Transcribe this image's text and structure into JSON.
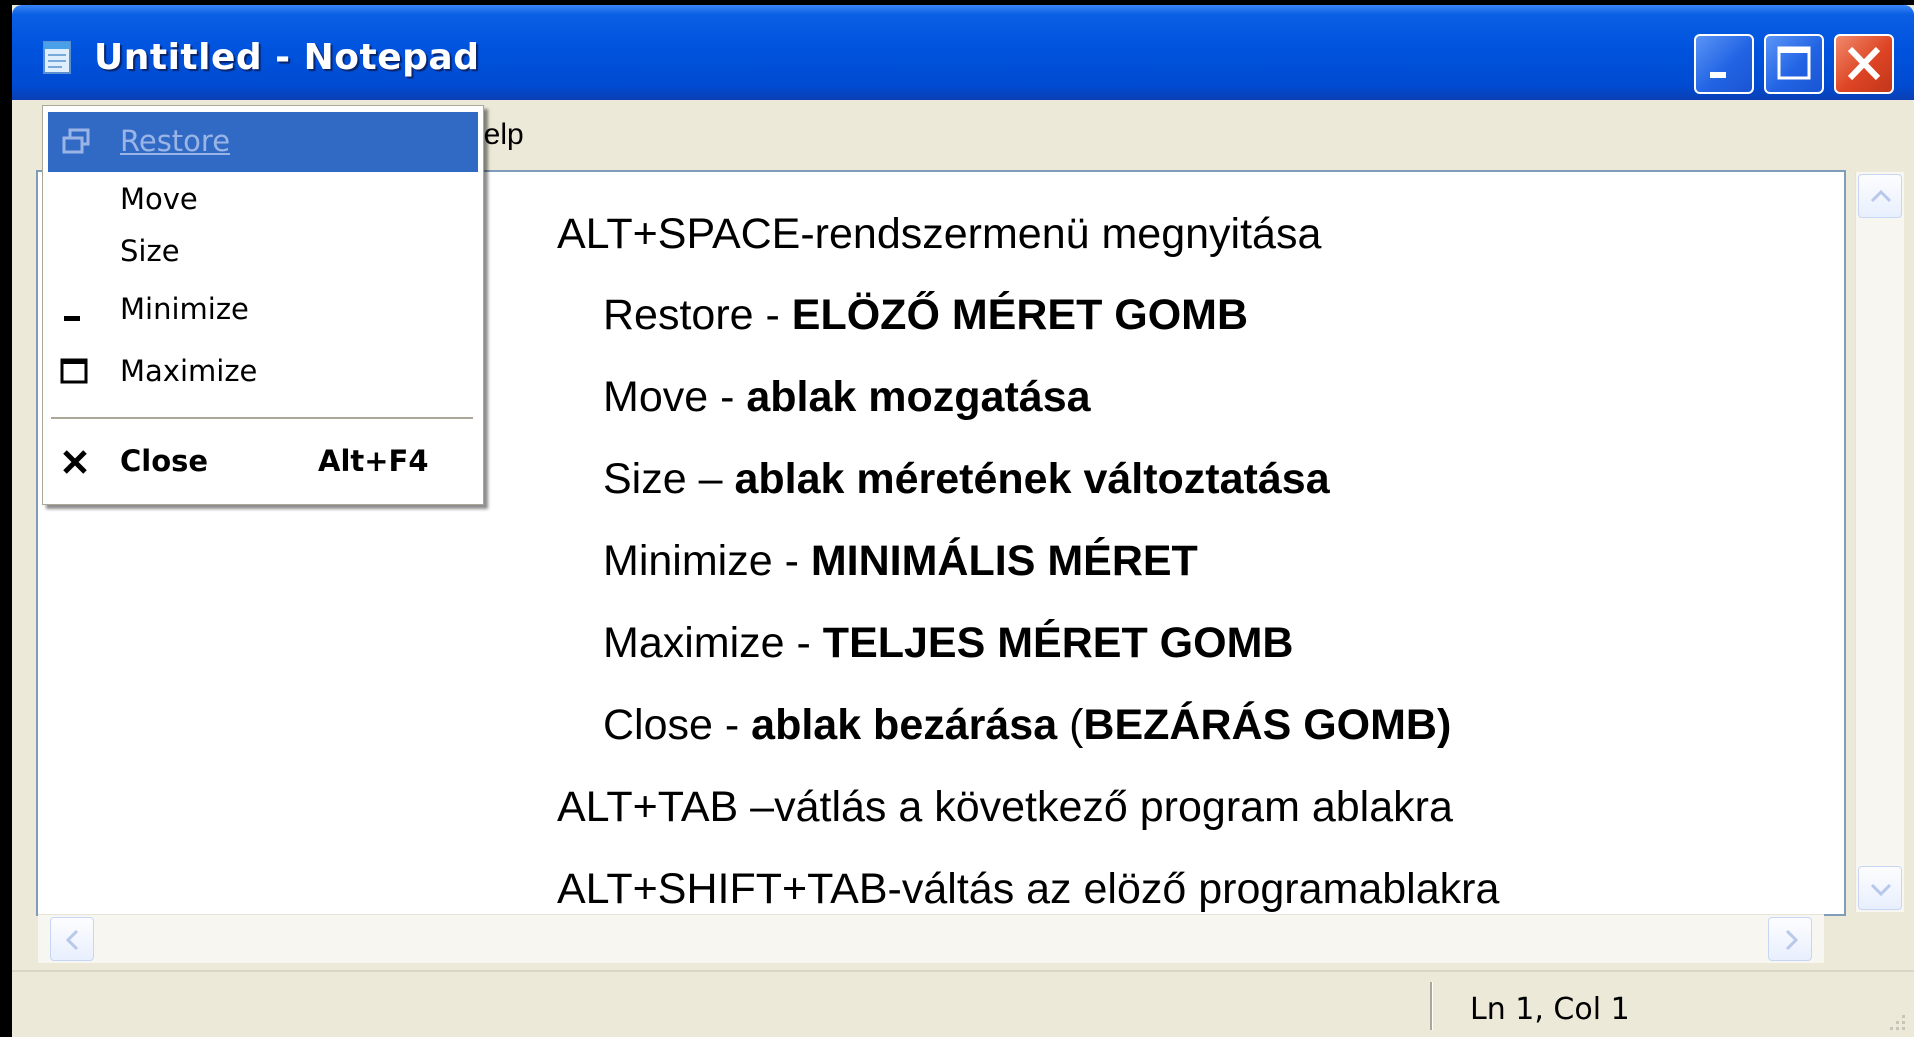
{
  "window": {
    "title": "Untitled - Notepad",
    "menu_help": "Help"
  },
  "system_menu": {
    "items": [
      {
        "label": "Restore",
        "icon": "restore-icon",
        "state": "highlighted-disabled"
      },
      {
        "label": "Move"
      },
      {
        "label": "Size"
      },
      {
        "label": "Minimize",
        "icon": "minimize-icon"
      },
      {
        "label": "Maximize",
        "icon": "maximize-icon"
      },
      {
        "label": "Close",
        "icon": "close-icon",
        "accelerator": "Alt+F4"
      }
    ]
  },
  "content": {
    "l1": "ALT+SPACE-rendszermenü megnyitása",
    "l2a": "Restore - ",
    "l2b": "ELÖZŐ  MÉRET GOMB",
    "l3a": "Move - ",
    "l3b": "ablak mozgatása",
    "l4a": "Size – ",
    "l4b": "ablak méretének változtatása",
    "l5a": "Minimize - ",
    "l5b": "MINIMÁLIS MÉRET",
    "l6a": "Maximize - ",
    "l6b": "TELJES MÉRET GOMB",
    "l7a": "Close - ",
    "l7b": "ablak bezárása",
    "l7c": " (",
    "l7d": "BEZÁRÁS GOMB)",
    "l8": "ALT+TAB –vátlás a következő program ablakra",
    "l9": "ALT+SHIFT+TAB-váltás az elöző programablakra"
  },
  "status": {
    "position": "Ln 1, Col 1"
  },
  "colors": {
    "titlebar": "#0053de",
    "menu_highlight": "#316ac5",
    "close_button": "#dd4424"
  }
}
